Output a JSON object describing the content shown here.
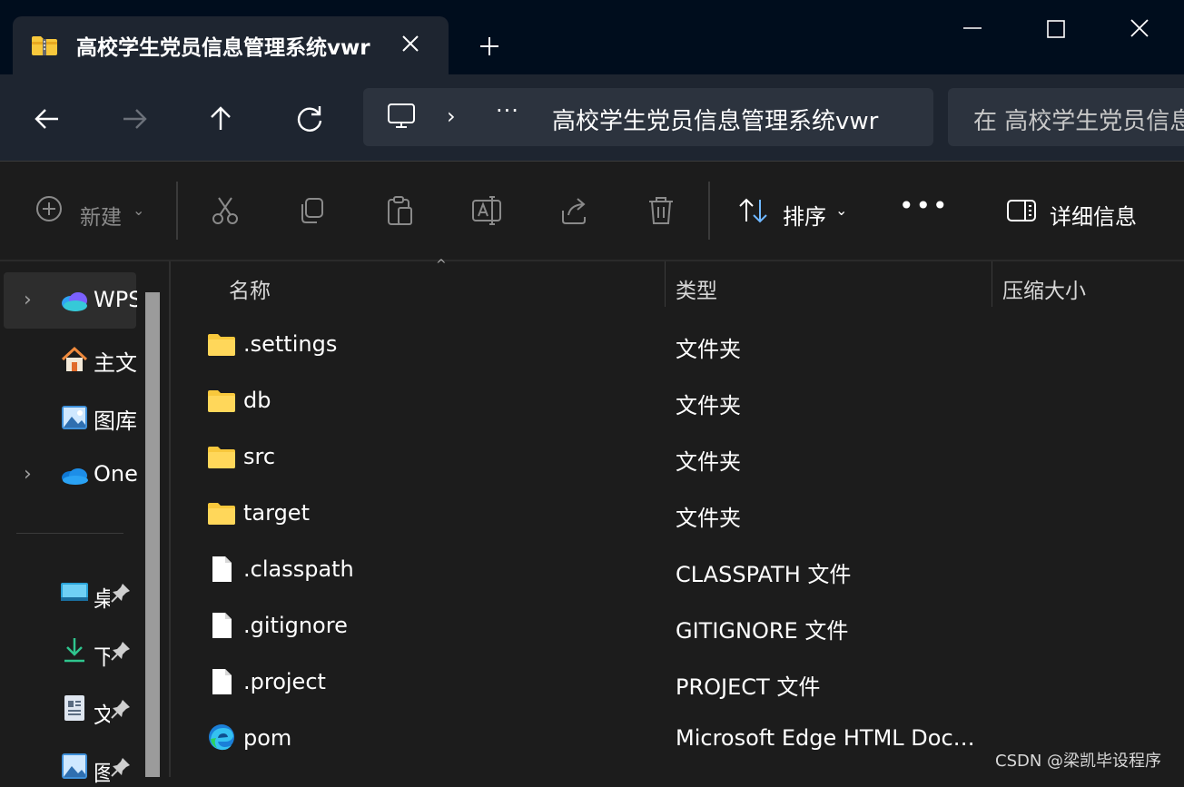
{
  "window": {
    "tab_title": "高校学生党员信息管理系统vwr",
    "tab_icon": "zipped-folder-icon",
    "buttons": {
      "minimize": "minimize-icon",
      "maximize": "maximize-icon",
      "close": "close-icon"
    }
  },
  "nav": {
    "address": {
      "more": "···",
      "path": "高校学生党员信息管理系统vwr"
    },
    "search_placeholder": "在 高校学生党员信息管理系统vwr 中搜索"
  },
  "toolbar": {
    "new_label": "新建",
    "sort_label": "排序",
    "more_label": "•••",
    "details_label": "详细信息"
  },
  "sidebar": {
    "items": [
      {
        "label": "WPS",
        "icon": "wps-cloud-icon",
        "expandable": true,
        "selected": true
      },
      {
        "label": "主文",
        "icon": "home-icon",
        "expandable": false
      },
      {
        "label": "图库",
        "icon": "gallery-icon",
        "expandable": false
      },
      {
        "label": "One",
        "icon": "onedrive-icon",
        "expandable": true
      }
    ],
    "pinned": [
      {
        "label": "桌",
        "icon": "desktop-folder-icon"
      },
      {
        "label": "下",
        "icon": "downloads-icon"
      },
      {
        "label": "文",
        "icon": "documents-icon"
      },
      {
        "label": "图",
        "icon": "pictures-icon"
      }
    ]
  },
  "columns": {
    "name": "名称",
    "type": "类型",
    "size": "压缩大小"
  },
  "files": [
    {
      "name": ".settings",
      "type": "文件夹",
      "icon": "folder-icon"
    },
    {
      "name": "db",
      "type": "文件夹",
      "icon": "folder-icon"
    },
    {
      "name": "src",
      "type": "文件夹",
      "icon": "folder-icon"
    },
    {
      "name": "target",
      "type": "文件夹",
      "icon": "folder-icon"
    },
    {
      "name": ".classpath",
      "type": "CLASSPATH 文件",
      "icon": "file-icon"
    },
    {
      "name": ".gitignore",
      "type": "GITIGNORE 文件",
      "icon": "file-icon"
    },
    {
      "name": ".project",
      "type": "PROJECT 文件",
      "icon": "file-icon"
    },
    {
      "name": "pom",
      "type": "Microsoft Edge HTML Document",
      "icon": "edge-icon"
    }
  ],
  "watermark": "CSDN @梁凯毕设程序",
  "colors": {
    "title_bar": "#000d1d",
    "nav_bar": "#1e2530",
    "background": "#1c1c1c",
    "folder": "#f8c83c"
  }
}
